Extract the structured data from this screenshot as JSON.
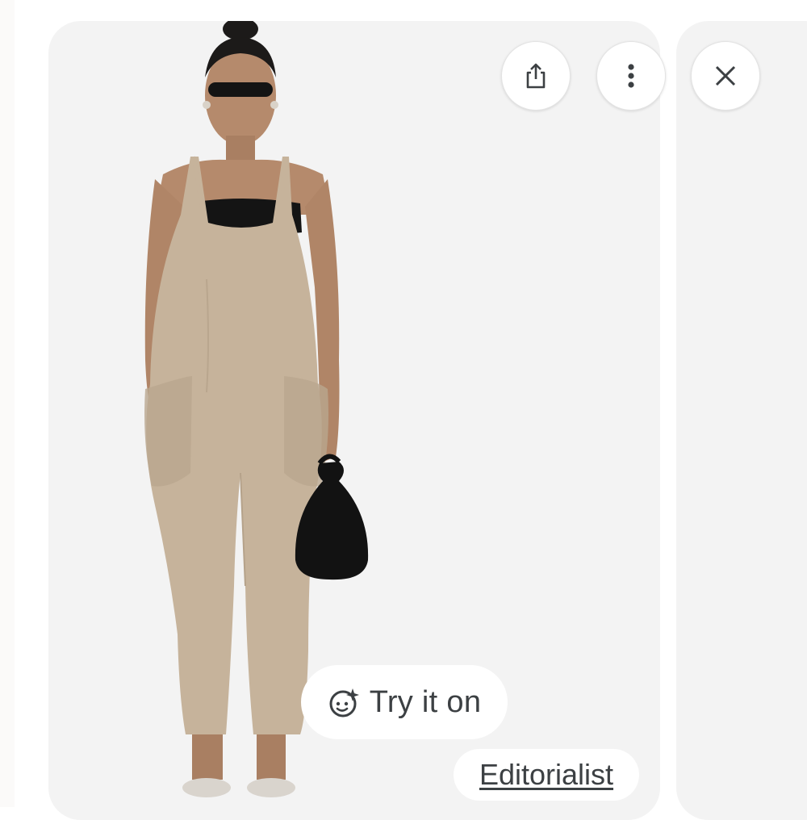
{
  "toolbar": {
    "share_icon": "share-icon",
    "more_icon": "more-vert-icon",
    "close_icon": "close-icon"
  },
  "product_image": {
    "garment_color": "#c6b39b",
    "background": "#f3f3f3"
  },
  "try_on": {
    "label": "Try it on",
    "icon": "sparkle-face-icon"
  },
  "source": {
    "label": "Editorialist"
  },
  "colors": {
    "button_text": "#3c4043",
    "card_bg": "#f3f3f3"
  }
}
